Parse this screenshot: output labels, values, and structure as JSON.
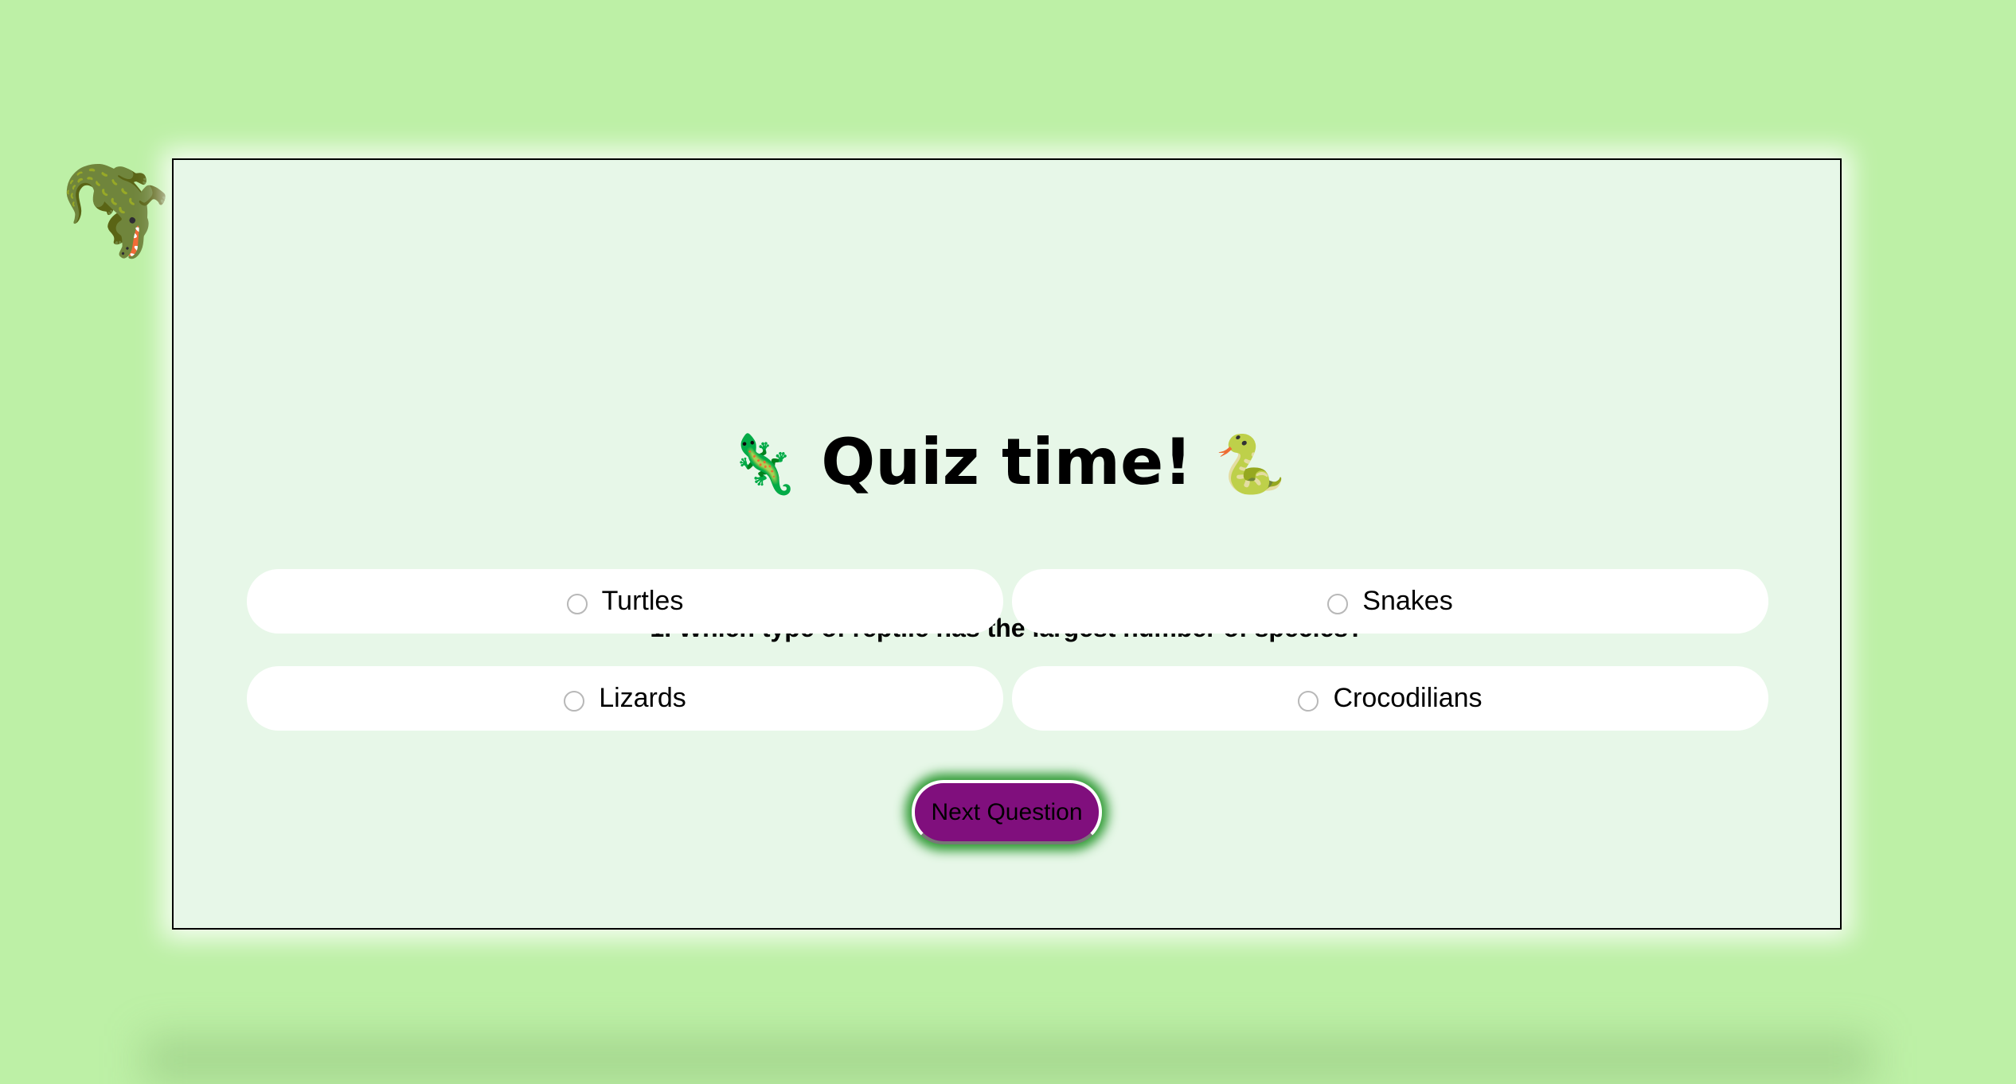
{
  "decor": {
    "crocodile_icon": "🐊"
  },
  "quiz": {
    "title_left_icon": "🦎",
    "title": "Quiz time!",
    "title_right_icon": "🐍",
    "question": "1. Which type of reptile has the largest number of species?",
    "options": [
      {
        "label": "Turtles",
        "selected": false
      },
      {
        "label": "Snakes",
        "selected": false
      },
      {
        "label": "Lizards",
        "selected": false
      },
      {
        "label": "Crocodilians",
        "selected": false
      }
    ],
    "next_label": "Next Question"
  },
  "colors": {
    "background": "#bdf0a6",
    "card": "#e7f7e8",
    "button": "#800f7d",
    "button_glow": "#2f9a34"
  }
}
